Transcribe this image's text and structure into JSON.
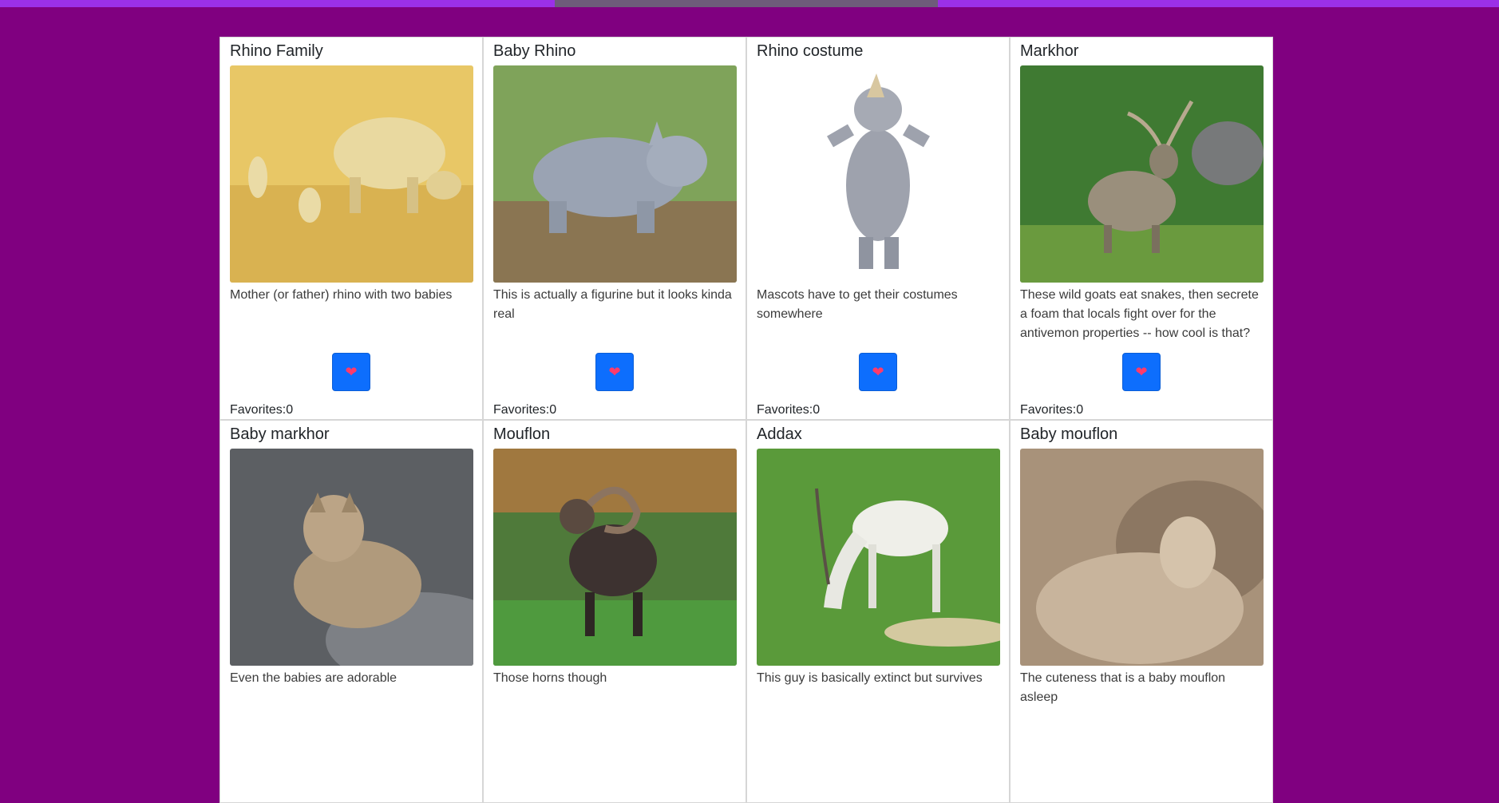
{
  "colors": {
    "page_bg": "#800080",
    "button_bg": "#0d6efd",
    "heart": "#ff3b6b"
  },
  "favorite_icon": "heart-icon",
  "cards": [
    {
      "title": "Rhino Family",
      "description": "Mother (or father) rhino with two babies",
      "favorites": "Favorites:0",
      "image_icon": "rhino-family-photo"
    },
    {
      "title": "Baby Rhino",
      "description": "This is actually a figurine but it looks kinda real",
      "favorites": "Favorites:0",
      "image_icon": "baby-rhino-photo"
    },
    {
      "title": "Rhino costume",
      "description": "Mascots have to get their costumes somewhere",
      "favorites": "Favorites:0",
      "image_icon": "rhino-costume-photo"
    },
    {
      "title": "Markhor",
      "description": "These wild goats eat snakes, then secrete a foam that locals fight over for the antivemon properties -- how cool is that?",
      "favorites": "Favorites:0",
      "image_icon": "markhor-photo"
    },
    {
      "title": "Baby markhor",
      "description": "Even the babies are adorable",
      "favorites": "",
      "image_icon": "baby-markhor-photo"
    },
    {
      "title": "Mouflon",
      "description": "Those horns though",
      "favorites": "",
      "image_icon": "mouflon-photo"
    },
    {
      "title": "Addax",
      "description": "This guy is basically extinct but survives",
      "favorites": "",
      "image_icon": "addax-photo"
    },
    {
      "title": "Baby mouflon",
      "description": "The cuteness that is a baby mouflon asleep",
      "favorites": "",
      "image_icon": "baby-mouflon-photo"
    }
  ]
}
